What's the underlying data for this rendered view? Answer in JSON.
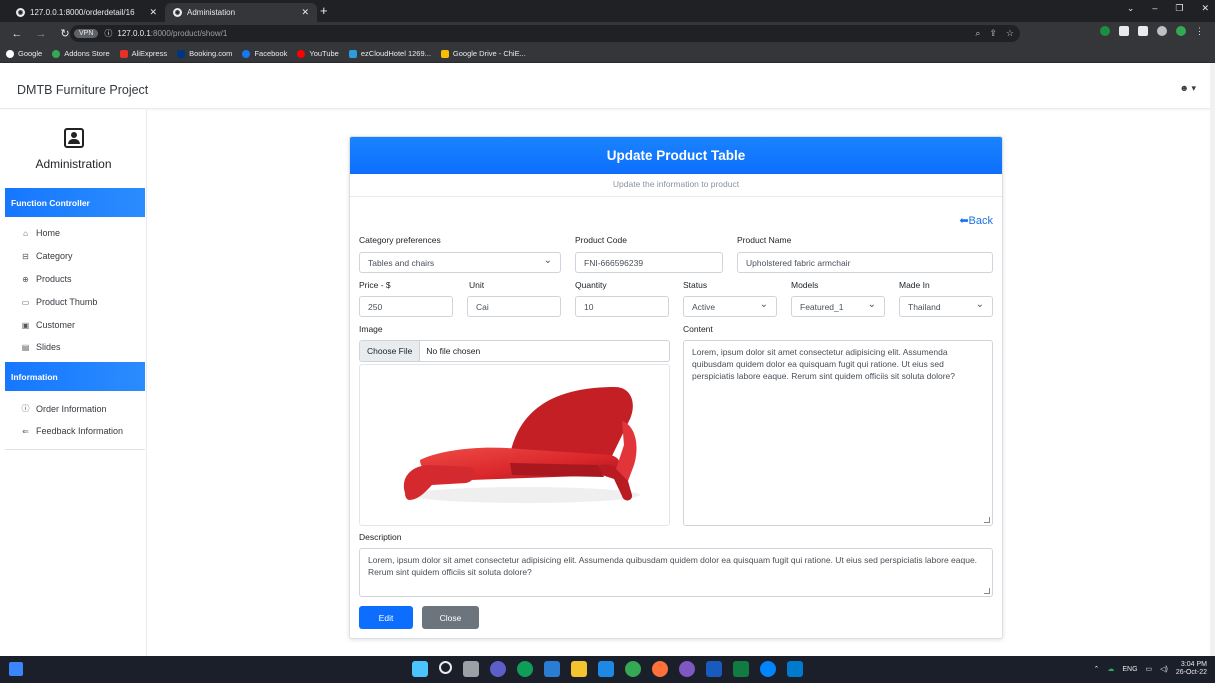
{
  "browser": {
    "tabs": [
      {
        "title": "127.0.0.1:8000/orderdetail/16",
        "active": false
      },
      {
        "title": "Administation",
        "active": true
      }
    ],
    "url_host": "127.0.0.1",
    "url_rest": ":8000/product/show/1",
    "vpn_badge": "VPN",
    "bookmarks": [
      "Google",
      "Addons Store",
      "AliExpress",
      "Booking.com",
      "Facebook",
      "YouTube",
      "ezCloudHotel 1269...",
      "Google Drive - ChiE..."
    ]
  },
  "header": {
    "brand": "DMTB Furniture Project",
    "user_menu": "☻ ▾"
  },
  "sidebar": {
    "title": "Administration",
    "sections": [
      {
        "label": "Function Controller",
        "items": [
          {
            "label": "Home",
            "icon": "home-icon"
          },
          {
            "label": "Category",
            "icon": "category-icon"
          },
          {
            "label": "Products",
            "icon": "products-icon"
          },
          {
            "label": "Product Thumb",
            "icon": "image-icon"
          },
          {
            "label": "Customer",
            "icon": "customer-icon"
          },
          {
            "label": "Slides",
            "icon": "slides-icon"
          }
        ]
      },
      {
        "label": "Information",
        "items": [
          {
            "label": "Order Information",
            "icon": "info-icon"
          },
          {
            "label": "Feedback Information",
            "icon": "feedback-icon"
          }
        ]
      }
    ]
  },
  "form": {
    "title": "Update Product Table",
    "subtitle": "Update the information to product",
    "back_label": "Back",
    "category_label": "Category preferences",
    "category_value": "Tables and chairs",
    "code_label": "Product Code",
    "code_value": "FNI-666596239",
    "name_label": "Product Name",
    "name_value": "Upholstered fabric armchair",
    "price_label": "Price - $",
    "price_value": "250",
    "unit_label": "Unit",
    "unit_value": "Cai",
    "quantity_label": "Quantity",
    "quantity_value": "10",
    "status_label": "Status",
    "status_value": "Active",
    "models_label": "Models",
    "models_value": "Featured_1",
    "madein_label": "Made In",
    "madein_value": "Thailand",
    "image_label": "Image",
    "file_button": "Choose File",
    "file_text": "No file chosen",
    "content_label": "Content",
    "content_value": "Lorem, ipsum dolor sit amet consectetur adipisicing elit. Assumenda quibusdam quidem dolor ea quisquam fugit qui ratione. Ut eius sed perspiciatis labore eaque. Rerum sint quidem officiis sit soluta dolore?",
    "description_label": "Description",
    "description_value": "Lorem, ipsum dolor sit amet consectetur adipisicing elit. Assumenda quibusdam quidem dolor ea quisquam fugit qui ratione. Ut eius sed perspiciatis labore eaque. Rerum sint quidem officiis sit soluta dolore?",
    "edit_label": "Edit",
    "close_label": "Close"
  },
  "taskbar": {
    "lang": "ENG",
    "time": "3:04 PM",
    "date": "26-Oct-22"
  },
  "colors": {
    "primary": "#0d6efd",
    "secondary": "#6c757d",
    "chair": "#d9262b"
  }
}
